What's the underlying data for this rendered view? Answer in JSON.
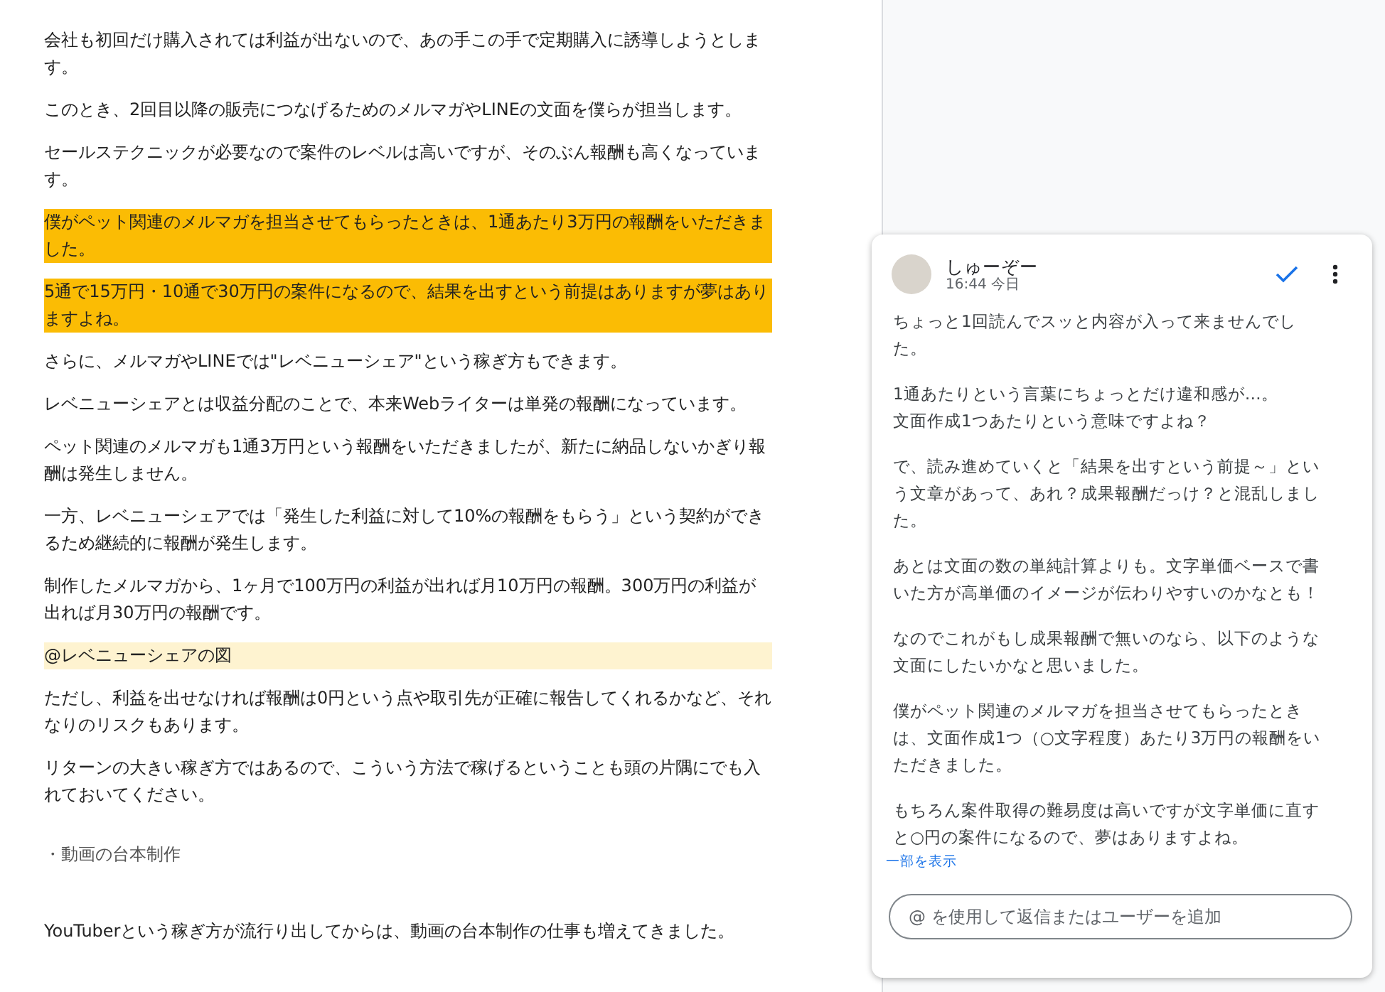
{
  "document": {
    "paragraphs": [
      {
        "kind": "text",
        "text": "会社も初回だけ購入されては利益が出ないので、あの手この手で定期購入に誘導しようとします。"
      },
      {
        "kind": "text",
        "text": "このとき、2回目以降の販売につなげるためのメルマガやLINEの文面を僕らが担当します。"
      },
      {
        "kind": "text",
        "text": "セールステクニックが必要なので案件のレベルは高いですが、そのぶん報酬も高くなっています。"
      },
      {
        "kind": "text",
        "text": "僕がペット関連のメルマガを担当させてもらったときは、1通あたり3万円の報酬をいただきました。",
        "color": "#fbbc04"
      },
      {
        "kind": "text",
        "text": "5通で15万円・10通で30万円の案件になるので、結果を出すという前提はありますが夢はありますよね。",
        "color": "#fbbc04"
      },
      {
        "kind": "text",
        "text": "さらに、メルマガやLINEでは\"レベニューシェア\"という稼ぎ方もできます。"
      },
      {
        "kind": "text",
        "text": "レベニューシェアとは収益分配のことで、本来Webライターは単発の報酬になっています。"
      },
      {
        "kind": "text",
        "text": "ペット関連のメルマガも1通3万円という報酬をいただきましたが、新たに納品しないかぎり報酬は発生しません。"
      },
      {
        "kind": "text",
        "text": "一方、レベニューシェアでは「発生した利益に対して10%の報酬をもらう」という契約ができるため継続的に報酬が発生します。"
      },
      {
        "kind": "text",
        "text": "制作したメルマガから、1ヶ月で100万円の利益が出れば月10万円の報酬。300万円の利益が出れば月30万円の報酬です。"
      },
      {
        "kind": "text",
        "text": "@レベニューシェアの図",
        "color": "#fef3d0"
      },
      {
        "kind": "text",
        "text": "ただし、利益を出せなければ報酬は0円という点や取引先が正確に報告してくれるかなど、それなりのリスクもあります。"
      },
      {
        "kind": "text",
        "text": "リターンの大きい稼ぎ方ではあるので、こういう方法で稼げるということも頭の片隅にでも入れておいてください。"
      },
      {
        "kind": "heading",
        "text": "・動画の台本制作"
      },
      {
        "kind": "text",
        "text": "YouTuberという稼ぎ方が流行り出してからは、動画の台本制作の仕事も増えてきました。"
      }
    ]
  },
  "comment": {
    "author": "しゅーぞー",
    "time": "16:44 今日",
    "resolved": false,
    "body": [
      [
        "ちょっと1回読んでスッと内容が入って来ませんでした。"
      ],
      [
        "1通あたりという言葉にちょっとだけ違和感が…。",
        "文面作成1つあたりという意味ですよね？"
      ],
      [
        "で、読み進めていくと「結果を出すという前提～」という文章があって、あれ？成果報酬だっけ？と混乱しました。"
      ],
      [
        "あとは文面の数の単純計算よりも。文字単価ベースで書いた方が高単価のイメージが伝わりやすいのかなとも！"
      ],
      [
        "なのでこれがもし成果報酬で無いのなら、以下のような文面にしたいかなと思いました。"
      ],
      [
        "僕がペット関連のメルマガを担当させてもらったときは、文面作成1つ（○文字程度）あたり3万円の報酬をいただきました。"
      ],
      [
        "もちろん案件取得の難易度は高いですが文字単価に直すと○円の案件になるので、夢はありますよね。"
      ]
    ],
    "show_more": "一部を表示",
    "reply": {
      "placeholder": "@ を使用して返信またはユーザーを追加"
    }
  }
}
